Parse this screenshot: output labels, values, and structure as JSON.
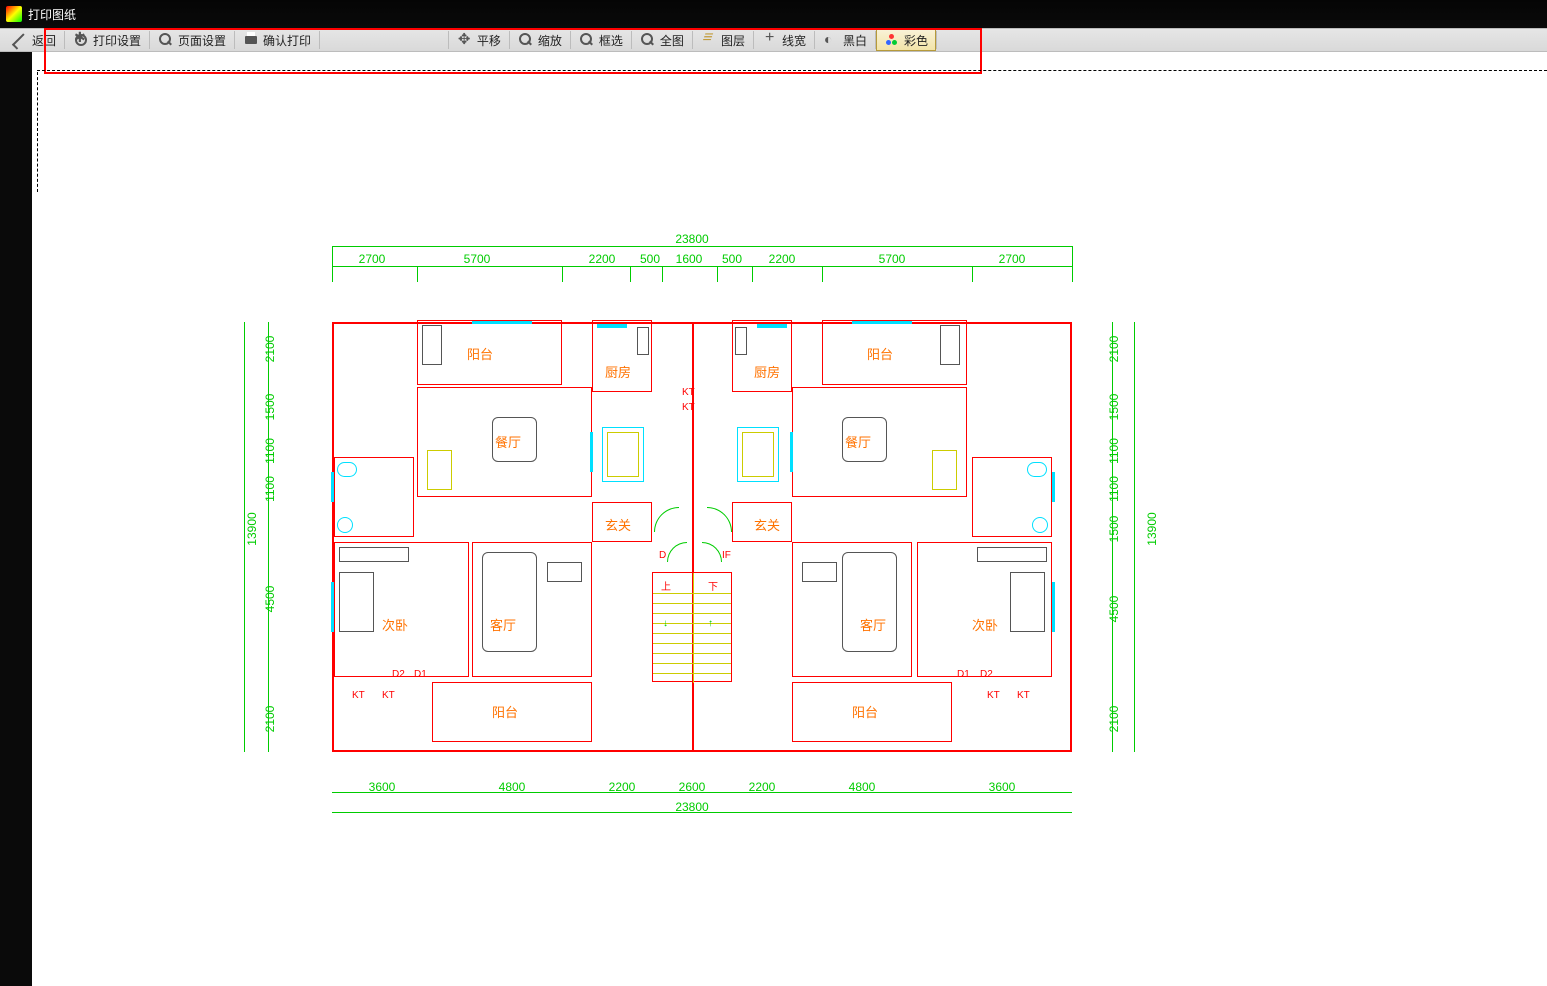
{
  "titlebar": {
    "title": "打印图纸"
  },
  "toolbar_left": {
    "back": "返回",
    "print_settings": "打印设置",
    "page_settings": "页面设置",
    "confirm_print": "确认打印"
  },
  "toolbar_right": {
    "pan": "平移",
    "zoom": "缩放",
    "box_select": "框选",
    "full_view": "全图",
    "layers": "图层",
    "line_width": "线宽",
    "black_white": "黑白",
    "color": "彩色"
  },
  "dimensions": {
    "top_total": "23800",
    "top_seg": [
      "2700",
      "5700",
      "2200",
      "500",
      "1600",
      "500",
      "2200",
      "5700",
      "2700"
    ],
    "left_total": "13900",
    "left_seg": [
      "2100",
      "1500",
      "1100",
      "1100",
      "4500",
      "2100"
    ],
    "right_total": "13900",
    "right_seg": [
      "2100",
      "1500",
      "1100",
      "1100",
      "1500",
      "4500",
      "2100"
    ],
    "bottom_total": "23800",
    "bottom_seg": [
      "3600",
      "4800",
      "2200",
      "2600",
      "2200",
      "4800",
      "3600"
    ]
  },
  "rooms": {
    "balcony": "阳台",
    "kitchen": "厨房",
    "dining": "餐厅",
    "entrance": "玄关",
    "living": "客厅",
    "bedroom2": "次卧"
  },
  "markers": {
    "kt": "KT",
    "d": "D",
    "if": "IF",
    "up": "上",
    "down": "下",
    "d1": "D1",
    "d2": "D2"
  }
}
